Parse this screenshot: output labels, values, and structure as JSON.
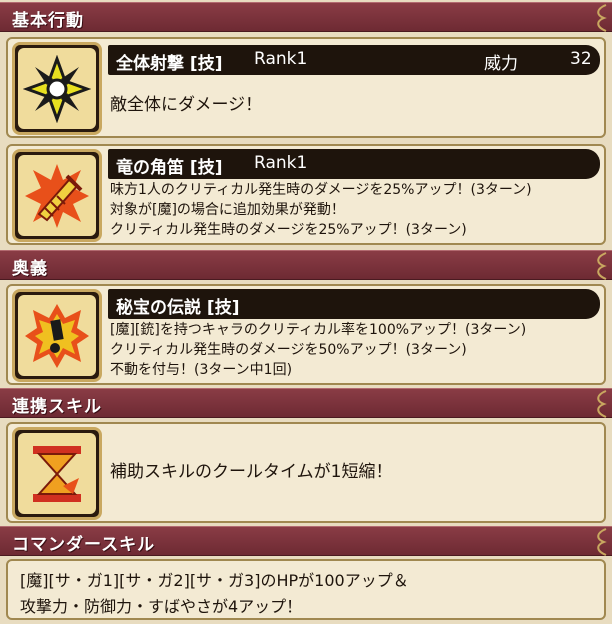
{
  "sections": {
    "basic": "基本行動",
    "ougi": "奥義",
    "renkei": "連携スキル",
    "commander": "コマンダースキル"
  },
  "skills": {
    "zentai": {
      "name": "全体射撃 [技]",
      "rank": "Rank1",
      "power_label": "威力",
      "power_value": "32",
      "desc": "敵全体にダメージ！",
      "icon": "shuriken-icon"
    },
    "ryu": {
      "name": "竜の角笛 [技]",
      "rank": "Rank1",
      "desc": [
        "味方1人のクリティカル発生時のダメージを25%アップ！(3ターン)",
        "対象が[魔]の場合に追加効果が発動！",
        "クリティカル発生時のダメージを25%アップ！(3ターン)"
      ],
      "icon": "horn-icon"
    },
    "hihou": {
      "name": "秘宝の伝説 [技]",
      "desc": [
        "[魔][銃]を持つキャラのクリティカル率を100%アップ！(3ターン)",
        "クリティカル発生時のダメージを50%アップ！(3ターン)",
        "不動を付与！(3ターン中1回)"
      ],
      "icon": "burst-icon"
    },
    "renkei": {
      "desc": "補助スキルのクールタイムが1短縮！",
      "icon": "hourglass-icon"
    }
  },
  "commander": {
    "line1": "[魔][サ・ガ1][サ・ガ2][サ・ガ3]のHPが100アップ＆",
    "line2": "攻撃力・防御力・すばやさが4アップ！"
  },
  "colors": {
    "header": "#7a3039",
    "background": "#e8dcc0",
    "bar": "#1e140c",
    "gold": "#c9a860"
  }
}
